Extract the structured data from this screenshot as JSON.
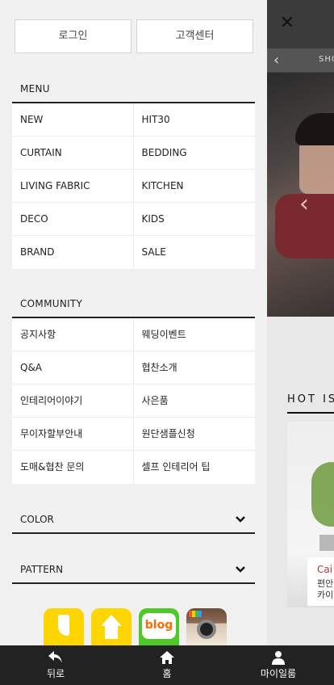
{
  "drawer": {
    "login_label": "로그인",
    "customer_center_label": "고객센터",
    "menu": {
      "title": "MENU",
      "rows": [
        [
          "NEW",
          "HIT30"
        ],
        [
          "CURTAIN",
          "BEDDING"
        ],
        [
          "LIVING FABRIC",
          "KITCHEN"
        ],
        [
          "DECO",
          "KIDS"
        ],
        [
          "BRAND",
          "SALE"
        ]
      ]
    },
    "community": {
      "title": "COMMUNITY",
      "rows": [
        [
          "공지사항",
          "웨딩이벤트"
        ],
        [
          "Q&A",
          "협찬소개"
        ],
        [
          "인테리어이야기",
          "사은품"
        ],
        [
          "무이자할부안내",
          "원단샘플신청"
        ],
        [
          "도매&협찬 문의",
          "셀프 인테리어 팁"
        ]
      ]
    },
    "color_label": "COLOR",
    "pattern_label": "PATTERN",
    "social": {
      "blog_label": "blog",
      "icons": [
        "kakaostory-icon",
        "ohouse-icon",
        "blog-icon",
        "instagram-icon"
      ]
    }
  },
  "background": {
    "close_symbol": "✕",
    "shop_text": "SHO",
    "hot_text": "HOT IS",
    "product_title": "Cai",
    "product_sub": "편안 카이"
  },
  "bottom_nav": {
    "back_label": "뒤로",
    "home_label": "홈",
    "mypage_label": "마이일룸"
  }
}
